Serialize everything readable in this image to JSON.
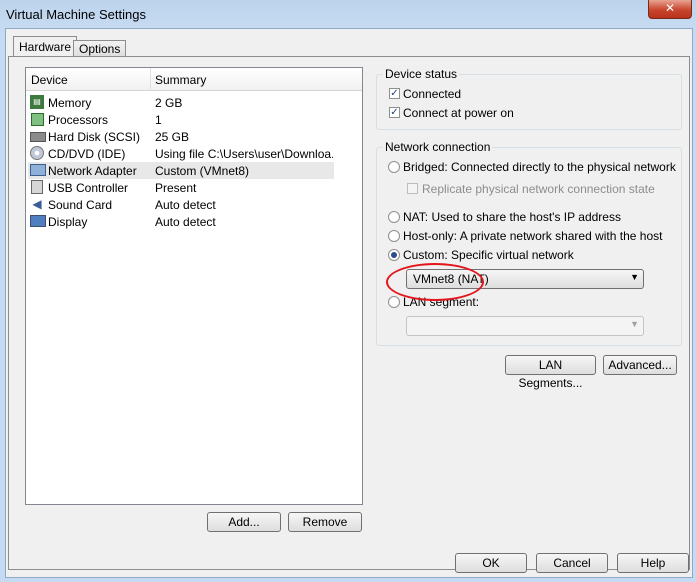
{
  "window": {
    "title": "Virtual Machine Settings",
    "close_glyph": "✕"
  },
  "tabs": [
    {
      "label": "Hardware",
      "active": true
    },
    {
      "label": "Options",
      "active": false
    }
  ],
  "device_list": {
    "columns": [
      "Device",
      "Summary"
    ],
    "rows": [
      {
        "device": "Memory",
        "summary": "2 GB",
        "icon": "memory-icon"
      },
      {
        "device": "Processors",
        "summary": "1",
        "icon": "processor-icon"
      },
      {
        "device": "Hard Disk (SCSI)",
        "summary": "25 GB",
        "icon": "hard-disk-icon"
      },
      {
        "device": "CD/DVD (IDE)",
        "summary": "Using file C:\\Users\\user\\Downloa...",
        "icon": "cd-dvd-icon"
      },
      {
        "device": "Network Adapter",
        "summary": "Custom (VMnet8)",
        "icon": "network-adapter-icon",
        "selected": true
      },
      {
        "device": "USB Controller",
        "summary": "Present",
        "icon": "usb-icon"
      },
      {
        "device": "Sound Card",
        "summary": "Auto detect",
        "icon": "sound-card-icon"
      },
      {
        "device": "Display",
        "summary": "Auto detect",
        "icon": "display-icon"
      }
    ]
  },
  "list_buttons": {
    "add": "Add...",
    "remove": "Remove"
  },
  "device_status": {
    "label": "Device status",
    "connected": {
      "label": "Connected",
      "checked": true
    },
    "connect_at_power_on": {
      "label": "Connect at power on",
      "checked": true
    }
  },
  "network_connection": {
    "label": "Network connection",
    "bridged": {
      "label": "Bridged: Connected directly to the physical network",
      "selected": false
    },
    "replicate": {
      "label": "Replicate physical network connection state",
      "checked": false,
      "enabled": false
    },
    "nat": {
      "label": "NAT: Used to share the host's IP address",
      "selected": false
    },
    "host_only": {
      "label": "Host-only: A private network shared with the host",
      "selected": false
    },
    "custom": {
      "label": "Custom: Specific virtual network",
      "selected": true
    },
    "custom_network_value": "VMnet8 (NAT)",
    "lan_segment": {
      "label": "LAN segment:",
      "selected": false
    },
    "lan_segment_value": ""
  },
  "network_buttons": {
    "lan_segments": "LAN Segments...",
    "advanced": "Advanced..."
  },
  "dialog_buttons": {
    "ok": "OK",
    "cancel": "Cancel",
    "help": "Help"
  },
  "colors": {
    "annotation": "#e3141b",
    "title_bar": "#bcd3ec",
    "radio_dot": "#2d4a8a"
  }
}
